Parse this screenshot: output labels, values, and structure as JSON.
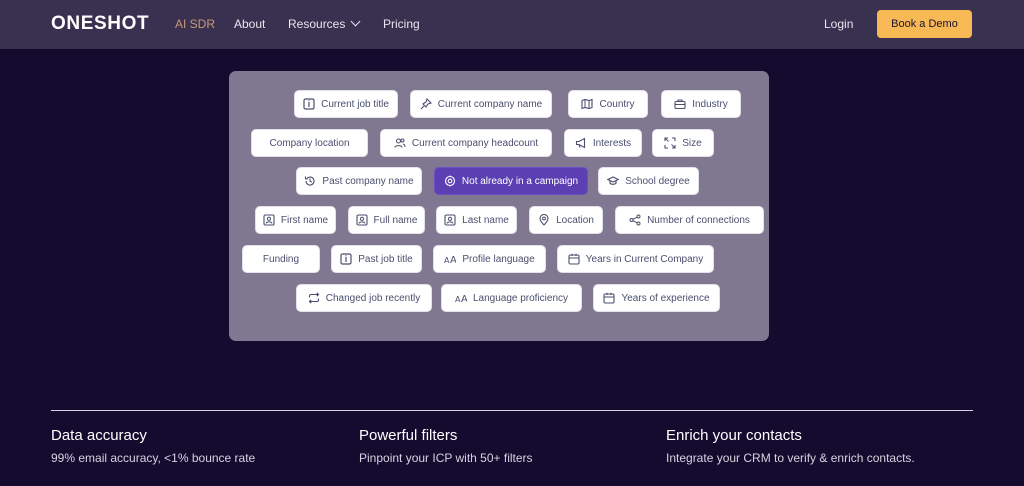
{
  "nav": {
    "logo": "ONESHOT",
    "links": [
      "AI SDR",
      "About",
      "Resources",
      "Pricing"
    ],
    "login": "Login",
    "cta": "Book a Demo"
  },
  "filters": [
    {
      "label": "Current job title",
      "icon": "id-card-icon"
    },
    {
      "label": "Current company name",
      "icon": "pin-icon"
    },
    {
      "label": "Country",
      "icon": "map-icon"
    },
    {
      "label": "Industry",
      "icon": "briefcase-icon"
    },
    {
      "label": "Company location",
      "icon": ""
    },
    {
      "label": "Current company headcount",
      "icon": "users-icon"
    },
    {
      "label": "Interests",
      "icon": "megaphone-icon"
    },
    {
      "label": "Size",
      "icon": "expand-icon"
    },
    {
      "label": "Past company name",
      "icon": "history-icon"
    },
    {
      "label": "Not already in a campaign",
      "icon": "target-icon"
    },
    {
      "label": "School degree",
      "icon": "graduation-cap-icon"
    },
    {
      "label": "First name",
      "icon": "contact-icon"
    },
    {
      "label": "Full name",
      "icon": "contact-icon"
    },
    {
      "label": "Last name",
      "icon": "contact-icon"
    },
    {
      "label": "Location",
      "icon": "location-pin-icon"
    },
    {
      "label": "Number of connections",
      "icon": "share-icon"
    },
    {
      "label": "Funding",
      "icon": ""
    },
    {
      "label": "Past job title",
      "icon": "id-card-icon"
    },
    {
      "label": "Profile language",
      "icon": "text-size-icon"
    },
    {
      "label": "Years in Current Company",
      "icon": "calendar-icon"
    },
    {
      "label": "Changed job recently",
      "icon": "repeat-icon"
    },
    {
      "label": "Language proficiency",
      "icon": "text-size-icon"
    },
    {
      "label": "Years of experience",
      "icon": "calendar-icon"
    }
  ],
  "selected_filter": "Not already in a campaign",
  "features": [
    {
      "title": "Data accuracy",
      "subtitle": "99% email accuracy, <1% bounce rate"
    },
    {
      "title": "Powerful filters",
      "subtitle": "Pinpoint your ICP with 50+ filters"
    },
    {
      "title": "Enrich your contacts",
      "subtitle": "Integrate your CRM to verify & enrich contacts."
    }
  ],
  "colors": {
    "background": "#140b2e",
    "nav": "#3a3150",
    "accent": "#f7b955",
    "active_link": "#c59a7a",
    "selected_chip": "#5b3fb3"
  }
}
